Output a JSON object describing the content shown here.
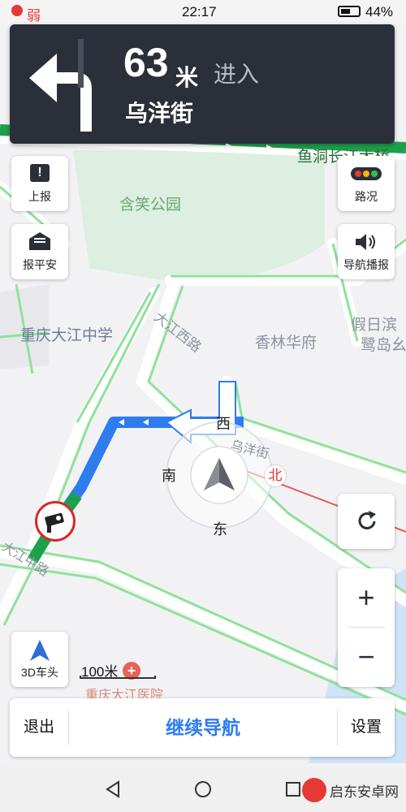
{
  "status_bar": {
    "signal_text": "弱",
    "time": "22:17",
    "battery": "44%"
  },
  "navigation": {
    "distance_value": "63",
    "distance_unit": "米",
    "action": "进入",
    "street": "乌洋街"
  },
  "map": {
    "labels": {
      "hanxiao_park": "含笑公园",
      "yudong": "鱼洞长江大桥",
      "dajiang_west_road": "大江西路",
      "xianglin": "香林华府",
      "school": "重庆大江中学",
      "jiari": "假日滨",
      "lu_dao": "鹭岛幺",
      "wuyang_street": "乌洋街",
      "dajiang_zhonglu": "大江中路",
      "dajiang_hospital": "重庆大江医院"
    },
    "compass": {
      "north": "北",
      "south": "南",
      "east": "东",
      "west": "西"
    },
    "scale": "100米"
  },
  "controls": {
    "report": "上报",
    "safe_report": "报平安",
    "traffic": "路况",
    "voice": "导航播报",
    "view_mode": "3D车头",
    "zoom_in": "+",
    "zoom_out": "−"
  },
  "bottom_bar": {
    "exit": "退出",
    "continue": "继续导航",
    "settings": "设置"
  },
  "watermark": "启东安卓网"
}
